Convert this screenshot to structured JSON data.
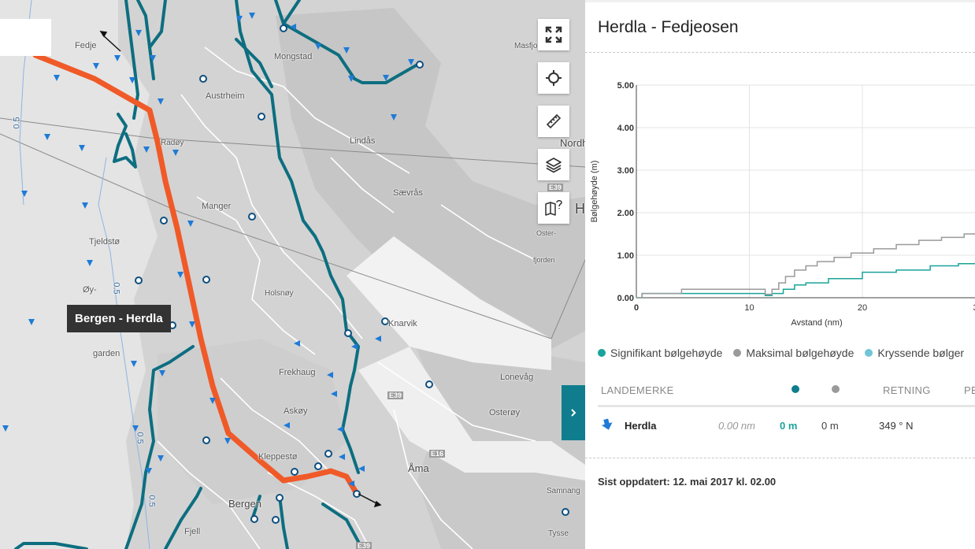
{
  "map": {
    "route_label": "Bergen - Herdla",
    "place_names": [
      {
        "name": "Fedje"
      },
      {
        "name": "Mongstad"
      },
      {
        "name": "Masfjo-"
      },
      {
        "name": "Austrheim"
      },
      {
        "name": "Radøy"
      },
      {
        "name": "Lindås"
      },
      {
        "name": "Nordh"
      },
      {
        "name": "Sævrås"
      },
      {
        "name": "Manger"
      },
      {
        "name": "Tjeldstø"
      },
      {
        "name": "Øy-"
      },
      {
        "name": "Holsnøy"
      },
      {
        "name": "Knarvik"
      },
      {
        "name": "garden"
      },
      {
        "name": "Frekhaug"
      },
      {
        "name": "Lonevåg"
      },
      {
        "name": "Askøy"
      },
      {
        "name": "Osterøy"
      },
      {
        "name": "Kleppestø"
      },
      {
        "name": "Åma"
      },
      {
        "name": "Bergen"
      },
      {
        "name": "Fjell"
      },
      {
        "name": "Samnang"
      },
      {
        "name": "Tysse"
      },
      {
        "name": "Oster-"
      },
      {
        "name": "fjorden"
      },
      {
        "name": "H"
      }
    ],
    "road_shields": [
      "E39",
      "E39",
      "E16",
      "E39"
    ],
    "depth_labels": [
      "0.5",
      "0.5",
      "0.5",
      "0.5"
    ],
    "controls": [
      {
        "name": "fullscreen-icon"
      },
      {
        "name": "locate-icon"
      },
      {
        "name": "ruler-icon"
      },
      {
        "name": "layers-icon"
      },
      {
        "name": "map-help-icon"
      }
    ],
    "collapse_icon": "chevron-right-icon",
    "colors": {
      "route": "#f05a28",
      "ferry": "#0d6e80",
      "arrow": "#1e7bd6"
    }
  },
  "panel": {
    "title": "Herdla - Fedjeosen",
    "legend": [
      {
        "label": "Signifikant bølgehøyde",
        "color": "#1aa39a"
      },
      {
        "label": "Maksimal bølgehøyde",
        "color": "#9a9a9a"
      },
      {
        "label": "Kryssende bølger",
        "color": "#6ec6d6"
      }
    ],
    "table": {
      "headers": [
        "LANDEMERKE",
        "RETNING",
        "PE"
      ],
      "header_dots": [
        "#0f7d8e",
        "#9a9a9a"
      ],
      "rows": [
        {
          "icon": "arrow-down-icon",
          "name": "Herdla",
          "distance": "0.00 nm",
          "significant": "0 m",
          "maximum": "0 m",
          "direction": "349 ° N"
        }
      ]
    },
    "updated": "Sist oppdatert: 12. mai 2017 kl. 02.00"
  },
  "chart_data": {
    "type": "line",
    "xlabel": "Avstand (nm)",
    "ylabel": "Bølgehøyde (m)",
    "xlim": [
      0,
      30
    ],
    "ylim": [
      0,
      5
    ],
    "x_ticks": [
      "0",
      "10",
      "20",
      "3"
    ],
    "y_ticks": [
      "0.00",
      "1.00",
      "2.00",
      "3.00",
      "4.00",
      "5.00"
    ],
    "grid": true,
    "series": [
      {
        "name": "Signifikant bølgehøyde",
        "color": "#1aa39a",
        "points": [
          [
            0,
            0
          ],
          [
            0.5,
            0.1
          ],
          [
            4,
            0.1
          ],
          [
            11,
            0.1
          ],
          [
            11.4,
            0.05
          ],
          [
            12,
            0.1
          ],
          [
            13,
            0.2
          ],
          [
            14,
            0.3
          ],
          [
            15,
            0.35
          ],
          [
            17,
            0.45
          ],
          [
            20,
            0.6
          ],
          [
            23,
            0.65
          ],
          [
            26,
            0.75
          ],
          [
            28.5,
            0.8
          ],
          [
            30,
            0.82
          ]
        ]
      },
      {
        "name": "Maksimal bølgehøyde",
        "color": "#9a9a9a",
        "points": [
          [
            0,
            0
          ],
          [
            0.5,
            0.1
          ],
          [
            4,
            0.2
          ],
          [
            11.2,
            0.2
          ],
          [
            11.4,
            0.08
          ],
          [
            12,
            0.2
          ],
          [
            12.6,
            0.35
          ],
          [
            13.2,
            0.5
          ],
          [
            14,
            0.65
          ],
          [
            15,
            0.75
          ],
          [
            16,
            0.85
          ],
          [
            17.5,
            0.95
          ],
          [
            19,
            1.05
          ],
          [
            21,
            1.15
          ],
          [
            23,
            1.25
          ],
          [
            25,
            1.35
          ],
          [
            27,
            1.42
          ],
          [
            29,
            1.5
          ],
          [
            30,
            1.52
          ]
        ]
      }
    ]
  }
}
